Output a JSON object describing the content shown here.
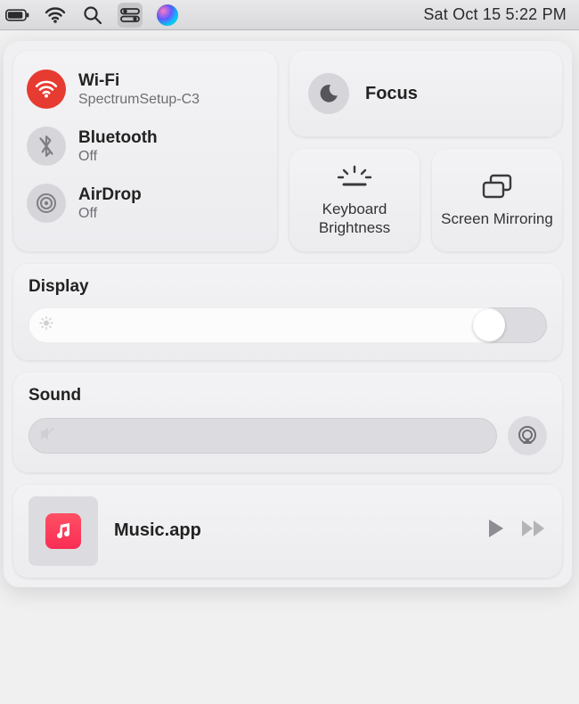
{
  "menubar": {
    "datetime": "Sat Oct 15  5:22 PM"
  },
  "connectivity": {
    "wifi": {
      "title": "Wi-Fi",
      "sub": "SpectrumSetup-C3",
      "on": true
    },
    "bluetooth": {
      "title": "Bluetooth",
      "sub": "Off",
      "on": false
    },
    "airdrop": {
      "title": "AirDrop",
      "sub": "Off",
      "on": false
    }
  },
  "focus": {
    "label": "Focus"
  },
  "shortcuts": {
    "keyboard_brightness": "Keyboard Brightness",
    "screen_mirroring": "Screen Mirroring"
  },
  "display": {
    "label": "Display",
    "value_percent": 92
  },
  "sound": {
    "label": "Sound",
    "value_percent": 0
  },
  "now_playing": {
    "title": "Music.app"
  }
}
